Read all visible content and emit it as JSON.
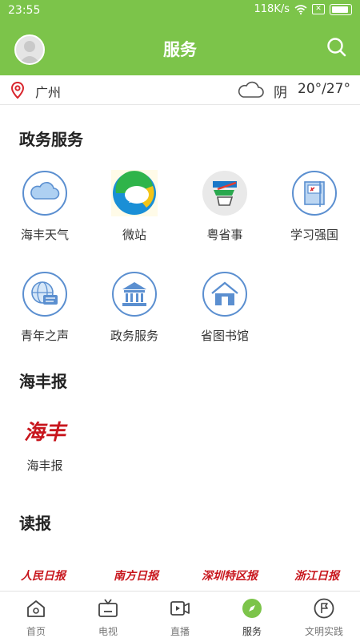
{
  "statusbar": {
    "time": "23:55",
    "speed": "118K/s",
    "x_label": "✕"
  },
  "header": {
    "title": "服务"
  },
  "location": {
    "city": "广州",
    "condition": "阴",
    "temperature": "20°/27°"
  },
  "sections": {
    "gov": {
      "title": "政务服务",
      "items": [
        {
          "label": "海丰天气",
          "icon": "cloud-icon"
        },
        {
          "label": "微站",
          "icon": "micro-station-icon"
        },
        {
          "label": "粤省事",
          "icon": "yue-sheng-shi-icon"
        },
        {
          "label": "学习强国",
          "icon": "xuexi-qiangguo-icon"
        },
        {
          "label": "青年之声",
          "icon": "globe-chat-icon"
        },
        {
          "label": "政务服务",
          "icon": "government-building-icon"
        },
        {
          "label": "省图书馆",
          "icon": "library-house-icon"
        }
      ]
    },
    "haifeng": {
      "title": "海丰报",
      "items": [
        {
          "label": "海丰报",
          "logo_text": "海丰"
        }
      ]
    },
    "read": {
      "title": "读报",
      "papers": [
        "人民日报",
        "南方日报",
        "深圳特区报",
        "浙江日报"
      ]
    }
  },
  "nav": {
    "items": [
      {
        "label": "首页",
        "icon": "home-icon"
      },
      {
        "label": "电视",
        "icon": "tv-icon"
      },
      {
        "label": "直播",
        "icon": "live-video-icon"
      },
      {
        "label": "服务",
        "icon": "compass-icon",
        "active": true
      },
      {
        "label": "文明实践",
        "icon": "flag-icon"
      }
    ]
  },
  "colors": {
    "brand_green": "#7cc44a",
    "icon_blue": "#5b8fd0",
    "paper_red": "#c8161d"
  }
}
